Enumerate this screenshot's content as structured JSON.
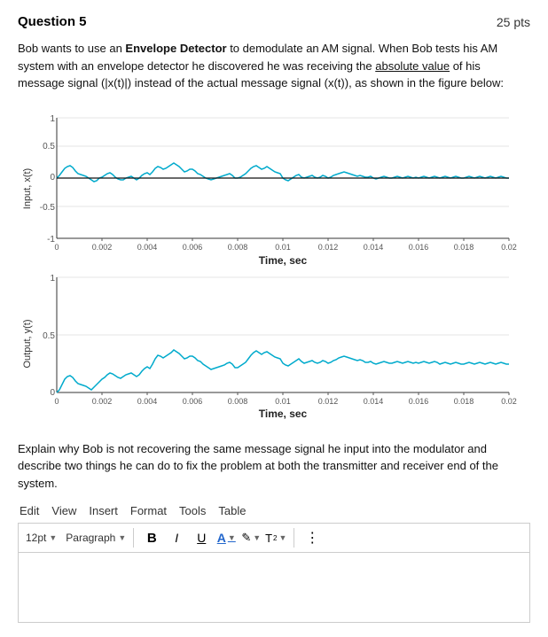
{
  "header": {
    "title": "Question 5",
    "points": "25 pts"
  },
  "description": {
    "text1": "Bob wants to use an ",
    "bold": "Envelope Detector",
    "text2": " to demodulate an AM signal. When Bob tests his AM system with an envelope detector he discovered he was receiving the ",
    "underline": "absolute value",
    "text3": " of his message signal (|x(t)|) instead of the actual message signal (x(t)), as shown in the figure below:"
  },
  "chart_top": {
    "y_label": "Input, x(t)",
    "x_label": "Time, sec",
    "y_max": "1",
    "y_mid": "0.5",
    "y_zero": "0",
    "y_neg": "-0.5",
    "y_min": "-1",
    "x_ticks": [
      "0",
      "0.002",
      "0.004",
      "0.006",
      "0.008",
      "0.01",
      "0.012",
      "0.014",
      "0.016",
      "0.018",
      "0.02"
    ]
  },
  "chart_bottom": {
    "y_label": "Output, y(t)",
    "x_label": "Time, sec",
    "y_max": "1",
    "y_mid": "0.5",
    "y_zero": "0",
    "x_ticks": [
      "0",
      "0.002",
      "0.004",
      "0.006",
      "0.008",
      "0.01",
      "0.012",
      "0.014",
      "0.016",
      "0.018",
      "0.02"
    ]
  },
  "explain": {
    "text": "Explain why Bob is not recovering the same message signal he input into the modulator and describe two things he can do to fix the problem at both the transmitter and receiver end of the system."
  },
  "menu": {
    "items": [
      "Edit",
      "View",
      "Insert",
      "Format",
      "Tools",
      "Table"
    ]
  },
  "toolbar": {
    "font_size": "12pt",
    "paragraph": "Paragraph",
    "bold": "B",
    "italic": "I",
    "underline": "U",
    "color_a": "A",
    "highlight": "✎",
    "superscript": "T²",
    "more": "⋮"
  }
}
